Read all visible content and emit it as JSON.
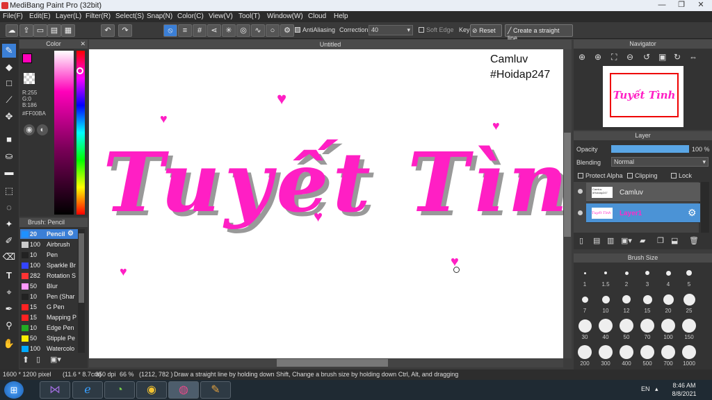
{
  "window": {
    "title": "MediBang Paint Pro (32bit)",
    "min": "—",
    "max": "❐",
    "close": "✕"
  },
  "menu": [
    "File(F)",
    "Edit(E)",
    "Layer(L)",
    "Filter(R)",
    "Select(S)",
    "Snap(N)",
    "Color(C)",
    "View(V)",
    "Tool(T)",
    "Window(W)",
    "Cloud",
    "Help"
  ],
  "toolbar": {
    "antialiasing_label": "AntiAliasing",
    "correction_label": "Correction",
    "correction_value": "40",
    "soft_edge_label": "Soft Edge",
    "key_label": "Key",
    "reset_label": "Reset",
    "straight_line_label": "Create a straight line"
  },
  "color_panel": {
    "title": "Color",
    "r": "R:255",
    "g": "G:0",
    "b": "B:186",
    "hex": "#FF00BA",
    "primary": "#ff00ba"
  },
  "brush_panel": {
    "title": "Brush: Pencil",
    "items": [
      {
        "size": "20",
        "name": "Pencil",
        "color": "#1e90ff"
      },
      {
        "size": "100",
        "name": "Airbrush",
        "color": "#cccccc"
      },
      {
        "size": "10",
        "name": "Pen",
        "color": "#222222"
      },
      {
        "size": "100",
        "name": "Sparkle Br",
        "color": "#3344ff"
      },
      {
        "size": "282",
        "name": "Rotation S",
        "color": "#ff3333"
      },
      {
        "size": "50",
        "name": "Blur",
        "color": "#ff99ff"
      },
      {
        "size": "10",
        "name": "Pen (Shar",
        "color": "#222222"
      },
      {
        "size": "15",
        "name": "G Pen",
        "color": "#ff2222"
      },
      {
        "size": "15",
        "name": "Mapping P",
        "color": "#ff2222"
      },
      {
        "size": "10",
        "name": "Edge Pen",
        "color": "#22aa22"
      },
      {
        "size": "50",
        "name": "Stipple Pe",
        "color": "#ffee00"
      },
      {
        "size": "100",
        "name": "Watercolo",
        "color": "#00aaff"
      }
    ]
  },
  "canvas": {
    "tab_title": "Untitled",
    "credit_line1": "Camluv",
    "credit_line2": "#Hoidap247",
    "lettering": "Tuyết Tình"
  },
  "navigator": {
    "title": "Navigator"
  },
  "layer_panel": {
    "title": "Layer",
    "opacity_label": "Opacity",
    "opacity_value": "100 %",
    "opacity_fraction": 1.0,
    "blending_label": "Blending",
    "blending_value": "Normal",
    "protect_alpha": "Protect Alpha",
    "clipping": "Clipping",
    "lock": "Lock",
    "layers": [
      {
        "name": "Camluv",
        "thumb_text": "Camluv #Hoidap247",
        "selected": false
      },
      {
        "name": "Layer1",
        "selected": true
      }
    ]
  },
  "brush_size_panel": {
    "title": "Brush Size",
    "sizes": [
      "1",
      "1.5",
      "2",
      "3",
      "4",
      "5",
      "7",
      "10",
      "12",
      "15",
      "20",
      "25",
      "30",
      "40",
      "50",
      "70",
      "100",
      "150",
      "200",
      "300",
      "400",
      "500",
      "700",
      "1000"
    ]
  },
  "status": {
    "pixels": "1600 * 1200 pixel",
    "physical": "(11.6 * 8.7cm)",
    "dpi": "350 dpi",
    "zoom": "66 %",
    "cursor": "(1212, 782 )",
    "hint": "Draw a straight line by holding down Shift, Change a brush size by holding down Ctrl, Alt, and dragging"
  },
  "taskbar": {
    "lang": "EN",
    "time": "8:46 AM",
    "date": "8/8/2021"
  }
}
